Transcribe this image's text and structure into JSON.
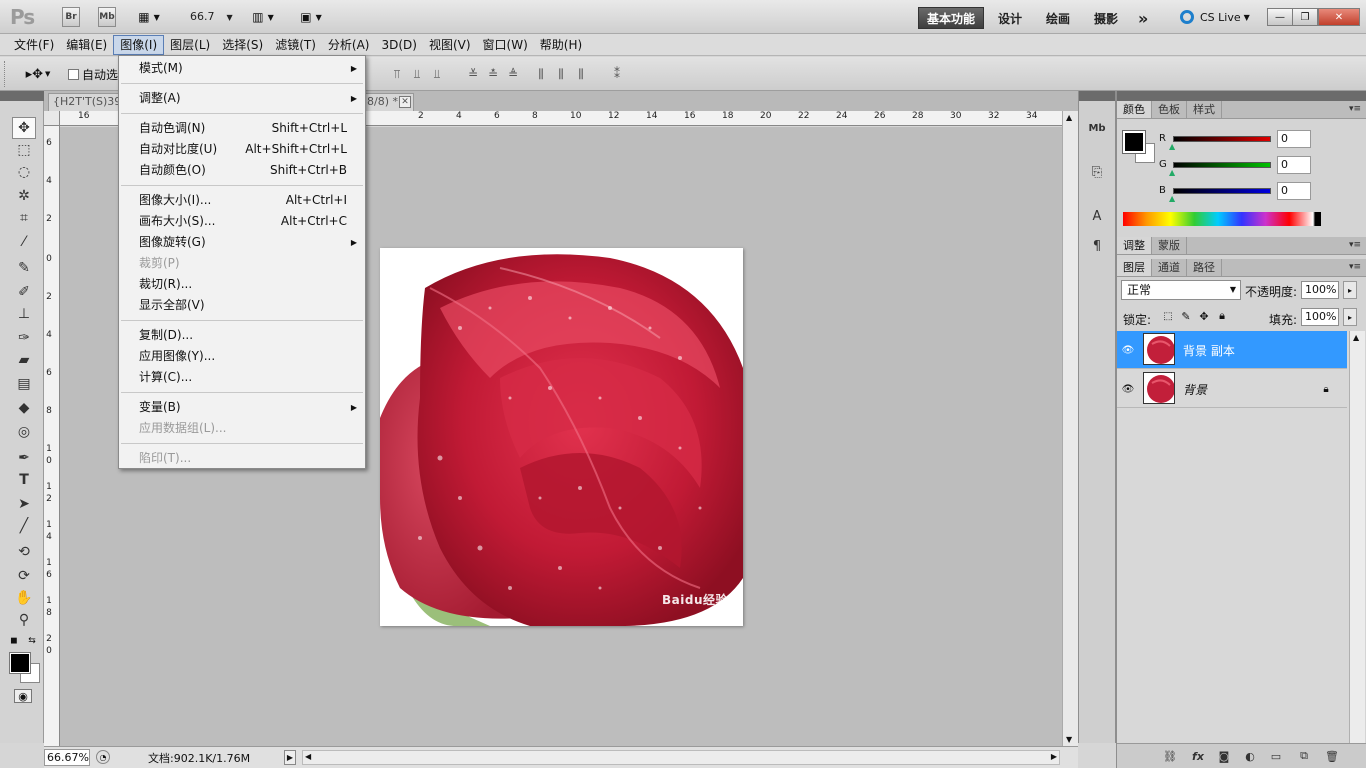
{
  "app": {
    "logo": "Ps",
    "launch_buttons": [
      "Br",
      "Mb"
    ],
    "zoom": "66.7",
    "workspaces": [
      "基本功能",
      "设计",
      "绘画",
      "摄影"
    ],
    "more": "»",
    "cs_live": "CS Live",
    "window_buttons": [
      "—",
      "❐",
      "✕"
    ]
  },
  "menubar": [
    "文件(F)",
    "编辑(E)",
    "图像(I)",
    "图层(L)",
    "选择(S)",
    "滤镜(T)",
    "分析(A)",
    "3D(D)",
    "视图(V)",
    "窗口(W)",
    "帮助(H)"
  ],
  "options": {
    "auto_select_label": "自动选"
  },
  "document": {
    "tab_left": "{H2T'T(S)39",
    "tab_right": "8/8) *",
    "close": "✕",
    "zoom_field": "66.67%",
    "doc_info": "文档:902.1K/1.76M",
    "watermark": "Baidu经验"
  },
  "rulers": {
    "top": [
      "16",
      "2",
      "4",
      "6",
      "8",
      "10",
      "12",
      "14",
      "16",
      "18",
      "20",
      "22",
      "24",
      "26",
      "28",
      "30",
      "32",
      "34"
    ],
    "left": [
      "6",
      "4",
      "2",
      "0",
      "2",
      "4",
      "6",
      "8",
      "1",
      "0",
      "1",
      "2",
      "1",
      "4",
      "1",
      "6",
      "1",
      "8",
      "2",
      "0"
    ]
  },
  "image_menu": {
    "items": [
      {
        "label": "模式(M)",
        "shortcut": "",
        "submenu": true,
        "disabled": false
      },
      {
        "sep": true
      },
      {
        "label": "调整(A)",
        "shortcut": "",
        "submenu": true,
        "disabled": false
      },
      {
        "sep": true
      },
      {
        "label": "自动色调(N)",
        "shortcut": "Shift+Ctrl+L",
        "submenu": false,
        "disabled": false
      },
      {
        "label": "自动对比度(U)",
        "shortcut": "Alt+Shift+Ctrl+L",
        "submenu": false,
        "disabled": false
      },
      {
        "label": "自动颜色(O)",
        "shortcut": "Shift+Ctrl+B",
        "submenu": false,
        "disabled": false
      },
      {
        "sep": true
      },
      {
        "label": "图像大小(I)...",
        "shortcut": "Alt+Ctrl+I",
        "submenu": false,
        "disabled": false
      },
      {
        "label": "画布大小(S)...",
        "shortcut": "Alt+Ctrl+C",
        "submenu": false,
        "disabled": false
      },
      {
        "label": "图像旋转(G)",
        "shortcut": "",
        "submenu": true,
        "disabled": false
      },
      {
        "label": "裁剪(P)",
        "shortcut": "",
        "submenu": false,
        "disabled": true
      },
      {
        "label": "裁切(R)...",
        "shortcut": "",
        "submenu": false,
        "disabled": false
      },
      {
        "label": "显示全部(V)",
        "shortcut": "",
        "submenu": false,
        "disabled": false
      },
      {
        "sep": true
      },
      {
        "label": "复制(D)...",
        "shortcut": "",
        "submenu": false,
        "disabled": false
      },
      {
        "label": "应用图像(Y)...",
        "shortcut": "",
        "submenu": false,
        "disabled": false
      },
      {
        "label": "计算(C)...",
        "shortcut": "",
        "submenu": false,
        "disabled": false
      },
      {
        "sep": true
      },
      {
        "label": "变量(B)",
        "shortcut": "",
        "submenu": true,
        "disabled": false
      },
      {
        "label": "应用数据组(L)...",
        "shortcut": "",
        "submenu": false,
        "disabled": true
      },
      {
        "sep": true
      },
      {
        "label": "陷印(T)...",
        "shortcut": "",
        "submenu": false,
        "disabled": true
      }
    ]
  },
  "color_panel": {
    "tabs": [
      "颜色",
      "色板",
      "样式"
    ],
    "channels": [
      {
        "name": "R",
        "value": "0",
        "color": "#e00000"
      },
      {
        "name": "G",
        "value": "0",
        "color": "#00c000"
      },
      {
        "name": "B",
        "value": "0",
        "color": "#0000e0"
      }
    ]
  },
  "adjust_panel": {
    "tabs": [
      "调整",
      "蒙版"
    ]
  },
  "layers_panel": {
    "tabs": [
      "图层",
      "通道",
      "路径"
    ],
    "blend_mode": "正常",
    "opacity_label": "不透明度:",
    "opacity": "100%",
    "lock_label": "锁定:",
    "fill_label": "填充:",
    "fill": "100%",
    "layers": [
      {
        "name": "背景 副本",
        "selected": true,
        "locked": false
      },
      {
        "name": "背景",
        "selected": false,
        "locked": true
      }
    ]
  },
  "icons": {
    "eye": "eye-icon",
    "lock": "lock-icon"
  },
  "colors": {
    "accent": "#3399ff",
    "rose": "#c21f3a"
  }
}
